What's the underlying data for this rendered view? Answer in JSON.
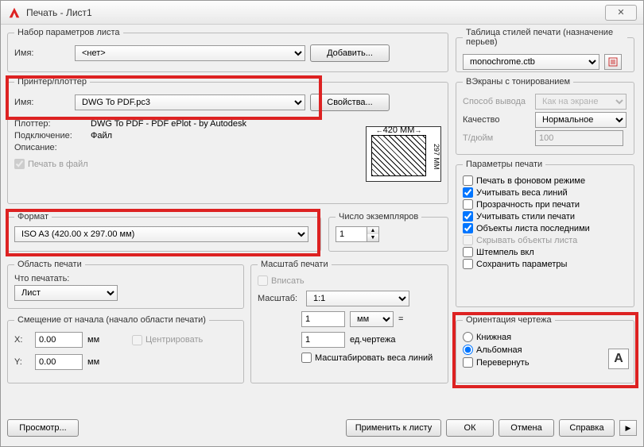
{
  "title": "Печать - Лист1",
  "close": "✕",
  "pageSetup": {
    "legend": "Набор параметров листа",
    "nameLabel": "Имя:",
    "nameValue": "<нет>",
    "addBtn": "Добавить..."
  },
  "plotStyle": {
    "legend": "Таблица стилей печати (назначение перьев)",
    "value": "monochrome.ctb"
  },
  "printer": {
    "legend": "Принтер/плоттер",
    "nameLabel": "Имя:",
    "nameValue": "DWG To PDF.pc3",
    "propsBtn": "Свойства...",
    "plotterLabel": "Плоттер:",
    "plotterValue": "DWG To PDF - PDF ePlot - by Autodesk",
    "connLabel": "Подключение:",
    "connValue": "Файл",
    "descLabel": "Описание:",
    "toFileLabel": "Печать в файл",
    "previewTop": "420 MM",
    "previewSide": "297 MM"
  },
  "viewports": {
    "legend": "ВЭкраны с тонированием",
    "methodLabel": "Способ вывода",
    "methodValue": "Как на экране",
    "qualLabel": "Качество",
    "qualValue": "Нормальное",
    "dpiLabel": "Т/дюйм",
    "dpiValue": "100"
  },
  "format": {
    "legend": "Формат",
    "value": "ISO A3 (420.00 x 297.00 мм)"
  },
  "copies": {
    "legend": "Число экземпляров",
    "value": "1"
  },
  "printParams": {
    "legend": "Параметры печати",
    "bg": "Печать в фоновом режиме",
    "weights": "Учитывать веса линий",
    "trans": "Прозрачность при печати",
    "styles": "Учитывать стили печати",
    "sheets": "Объекты листа последними",
    "hide": "Скрывать объекты листа",
    "stamp": "Штемпель вкл",
    "save": "Сохранить параметры"
  },
  "area": {
    "legend": "Область печати",
    "whatLabel": "Что печатать:",
    "whatValue": "Лист"
  },
  "scale": {
    "legend": "Масштаб печати",
    "fitLabel": "Вписать",
    "scaleLabel": "Масштаб:",
    "scaleValue": "1:1",
    "v1": "1",
    "unit": "мм",
    "eq": "=",
    "v2": "1",
    "units": "ед.чертежа",
    "lw": "Масштабировать веса линий"
  },
  "offset": {
    "legend": "Смещение от начала (начало области печати)",
    "xLabel": "X:",
    "xVal": "0.00",
    "yLabel": "Y:",
    "yVal": "0.00",
    "mm": "мм",
    "center": "Центрировать"
  },
  "orient": {
    "legend": "Ориентация чертежа",
    "portrait": "Книжная",
    "landscape": "Альбомная",
    "flip": "Перевернуть",
    "A": "A"
  },
  "buttons": {
    "preview": "Просмотр...",
    "apply": "Применить к листу",
    "ok": "ОК",
    "cancel": "Отмена",
    "help": "Справка"
  }
}
